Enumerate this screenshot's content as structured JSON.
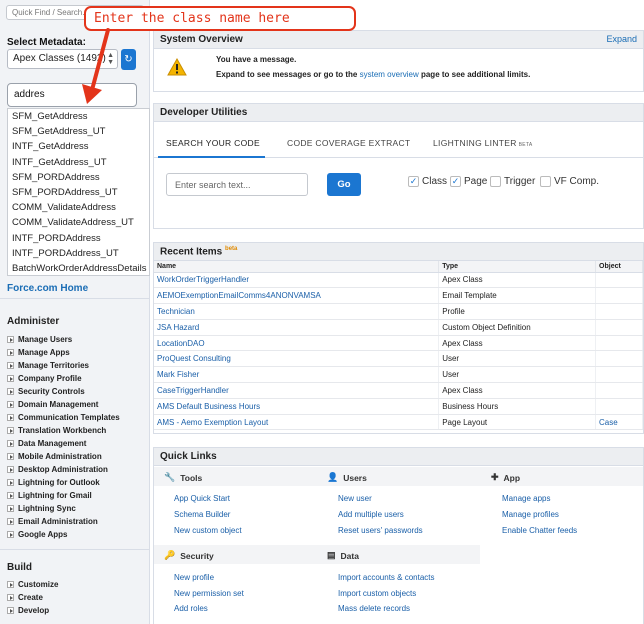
{
  "sidebar": {
    "quick_find_placeholder": "Quick Find / Search...",
    "select_metadata_label": "Select Metadata:",
    "metadata_select_value": "Apex Classes (1492)",
    "search_value": "addres",
    "suggestions": [
      "SFM_GetAddress",
      "SFM_GetAddress_UT",
      "INTF_GetAddress",
      "INTF_GetAddress_UT",
      "SFM_PORDAddress",
      "SFM_PORDAddress_UT",
      "COMM_ValidateAddress",
      "COMM_ValidateAddress_UT",
      "INTF_PORDAddress",
      "INTF_PORDAddress_UT",
      "BatchWorkOrderAddressDetails"
    ],
    "forcecom_home": "Force.com Home",
    "administer_title": "Administer",
    "administer_items": [
      "Manage Users",
      "Manage Apps",
      "Manage Territories",
      "Company Profile",
      "Security Controls",
      "Domain Management",
      "Communication Templates",
      "Translation Workbench",
      "Data Management",
      "Mobile Administration",
      "Desktop Administration",
      "Lightning for Outlook",
      "Lightning for Gmail",
      "Lightning Sync",
      "Email Administration",
      "Google Apps"
    ],
    "build_title": "Build",
    "build_items": [
      "Customize",
      "Create",
      "Develop"
    ]
  },
  "annotation": {
    "text": "Enter the class name here"
  },
  "system_overview": {
    "title": "System Overview",
    "expand": "Expand",
    "message": "You have a message.",
    "detail_before": "Expand to see messages or go to the",
    "detail_link": "system overview",
    "detail_after": "page to see additional limits."
  },
  "dev_utils": {
    "title": "Developer Utilities",
    "tabs": [
      "SEARCH YOUR CODE",
      "CODE COVERAGE EXTRACT",
      "LIGHTNING LINTER"
    ],
    "beta": "BETA",
    "search_placeholder": "Enter search text...",
    "go_label": "Go",
    "checkboxes": [
      {
        "label": "Class",
        "checked": true
      },
      {
        "label": "Page",
        "checked": true
      },
      {
        "label": "Trigger",
        "checked": false
      },
      {
        "label": "VF Comp.",
        "checked": false
      }
    ]
  },
  "recent_items": {
    "title": "Recent Items",
    "beta": "beta",
    "columns": [
      "Name",
      "Type",
      "Object"
    ],
    "rows": [
      [
        "WorkOrderTriggerHandler",
        "Apex Class",
        ""
      ],
      [
        "AEMOExemptionEmailComms4ANONVAMSA",
        "Email Template",
        ""
      ],
      [
        "Technician",
        "Profile",
        ""
      ],
      [
        "JSA Hazard",
        "Custom Object Definition",
        ""
      ],
      [
        "LocationDAO",
        "Apex Class",
        ""
      ],
      [
        "ProQuest Consulting",
        "User",
        ""
      ],
      [
        "Mark Fisher",
        "User",
        ""
      ],
      [
        "CaseTriggerHandler",
        "Apex Class",
        ""
      ],
      [
        "AMS Default Business Hours",
        "Business Hours",
        ""
      ],
      [
        "AMS - Aemo Exemption Layout",
        "Page Layout",
        "Case"
      ]
    ]
  },
  "quick_links": {
    "title": "Quick Links",
    "tools_title": "Tools",
    "tools": [
      "App Quick Start",
      "Schema Builder",
      "New custom object"
    ],
    "users_title": "Users",
    "users": [
      "New user",
      "Add multiple users",
      "Reset users' passwords"
    ],
    "app_title": "App",
    "app": [
      "Manage apps",
      "Manage profiles",
      "Enable Chatter feeds"
    ],
    "security_title": "Security",
    "security": [
      "New profile",
      "New permission set",
      "Add roles"
    ],
    "data_title": "Data",
    "data": [
      "Import accounts & contacts",
      "Import custom objects",
      "Mass delete records"
    ]
  },
  "colors": {
    "accent": "#1b76d1",
    "link": "#1a5fa8",
    "annotation": "#e3341a"
  }
}
